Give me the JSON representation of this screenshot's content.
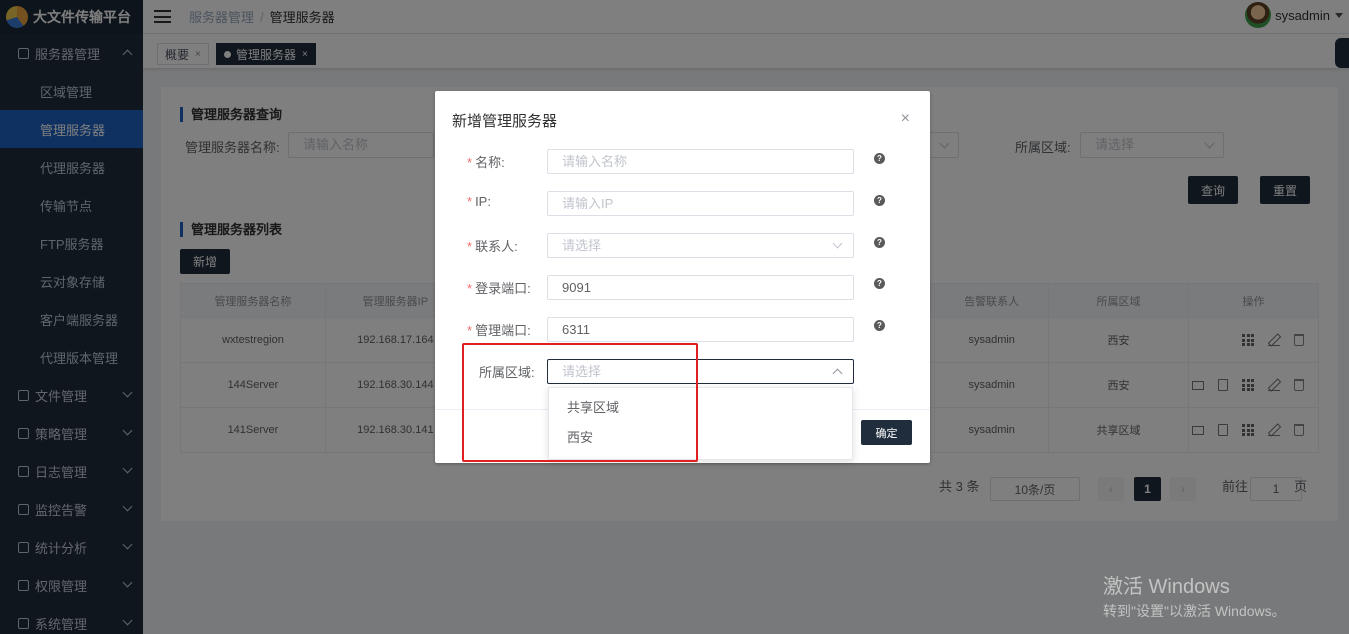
{
  "app": {
    "title": "大文件传输平台"
  },
  "sidebar": {
    "groups": [
      {
        "label": "服务器管理",
        "expanded": true
      },
      {
        "label": "文件管理"
      },
      {
        "label": "策略管理"
      },
      {
        "label": "日志管理"
      },
      {
        "label": "监控告警"
      },
      {
        "label": "统计分析"
      },
      {
        "label": "权限管理"
      },
      {
        "label": "系统管理"
      }
    ],
    "sub_items": [
      "区域管理",
      "管理服务器",
      "代理服务器",
      "传输节点",
      "FTP服务器",
      "云对象存储",
      "客户端服务器",
      "代理版本管理"
    ],
    "active_sub": "管理服务器"
  },
  "header": {
    "breadcrumb": [
      "服务器管理",
      "管理服务器"
    ],
    "user": "sysadmin"
  },
  "tags": [
    {
      "label": "概要",
      "close": "×"
    },
    {
      "label": "管理服务器",
      "close": "×",
      "active": true
    }
  ],
  "query": {
    "title": "管理服务器查询",
    "name_label": "管理服务器名称:",
    "name_placeholder": "请输入名称",
    "region_label": "所属区域:",
    "region_placeholder": "请选择",
    "search_btn": "查询",
    "reset_btn": "重置"
  },
  "list": {
    "title": "管理服务器列表",
    "add_btn": "新增",
    "columns": [
      "管理服务器名称",
      "管理服务器IP",
      "告警联系人",
      "所属区域",
      "操作"
    ],
    "rows": [
      {
        "name": "wxtestregion",
        "ip": "192.168.17.164",
        "contact": "sysadmin",
        "region": "西安"
      },
      {
        "name": "144Server",
        "ip": "192.168.30.144",
        "contact": "sysadmin",
        "region": "西安"
      },
      {
        "name": "141Server",
        "ip": "192.168.30.141",
        "contact": "sysadmin",
        "region": "共享区域"
      }
    ]
  },
  "pager": {
    "total": "共 3 条",
    "page_size": "10条/页",
    "current": "1",
    "goto_label": "前往",
    "goto_value": "1",
    "page_unit": "页"
  },
  "dialog": {
    "title": "新增管理服务器",
    "close": "×",
    "fields": [
      {
        "label": "名称:",
        "required": "*",
        "placeholder": "请输入名称"
      },
      {
        "label": "IP:",
        "required": "*",
        "placeholder": "请输入IP"
      },
      {
        "label": "联系人:",
        "required": "*",
        "placeholder": "请选择"
      },
      {
        "label": "登录端口:",
        "required": "*",
        "value": "9091"
      },
      {
        "label": "管理端口:",
        "required": "*",
        "value": "6311"
      },
      {
        "label": "所属区域:",
        "placeholder": "请选择"
      }
    ],
    "help": "?",
    "confirm": "确定",
    "region_options": [
      "共享区域",
      "西安"
    ]
  },
  "watermark": {
    "line1": "激活 Windows",
    "line2": "转到\"设置\"以激活 Windows。"
  }
}
